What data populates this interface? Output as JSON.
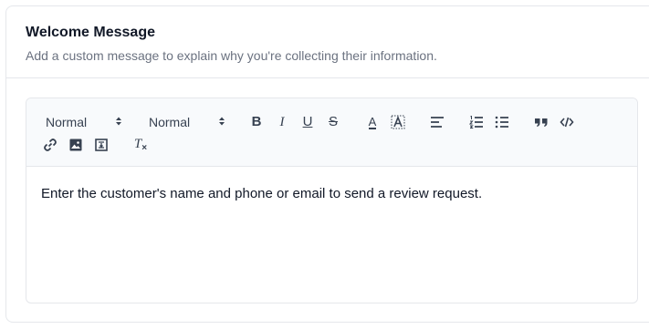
{
  "section": {
    "title": "Welcome Message",
    "description": "Add a custom message to explain why you're collecting their information."
  },
  "toolbar": {
    "header_select": "Normal",
    "size_select": "Normal",
    "bold": "B",
    "italic": "I",
    "underline": "U",
    "strike": "S",
    "color": "A",
    "background": "A",
    "clean": "T"
  },
  "editor": {
    "content": "Enter the customer's name and phone or email to send a review request."
  }
}
